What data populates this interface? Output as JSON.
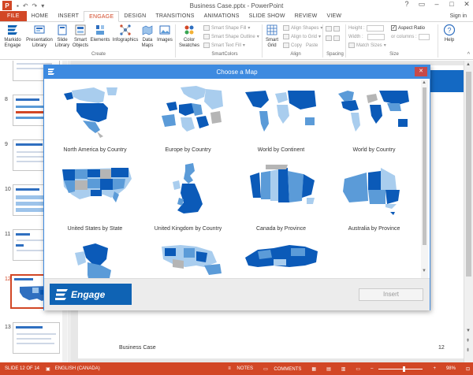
{
  "window": {
    "app_icon": "P",
    "title": "Business Case.pptx - PowerPoint",
    "controls": [
      "?",
      "▭",
      "–",
      "□",
      "✕"
    ]
  },
  "qat": [
    "save-icon",
    "undo-icon",
    "redo-icon",
    "customize-icon"
  ],
  "tabs": [
    "FILE",
    "HOME",
    "INSERT",
    "ENGAGE",
    "DESIGN",
    "TRANSITIONS",
    "ANIMATIONS",
    "SLIDE SHOW",
    "REVIEW",
    "VIEW"
  ],
  "active_tab": "ENGAGE",
  "signin": "Sign in",
  "ribbon": {
    "markido": "Markido\nEngage",
    "presentation_library": "Presentation\nLibrary",
    "slide_library": "Slide\nLibrary",
    "smart_objects": "Smart\nObjects",
    "elements": "Elements",
    "infographics": "Infographics",
    "data_maps": "Data\nMaps",
    "images": "Images",
    "color_swatches": "Color\nSwatches",
    "smart_shape_fill": "Smart Shape Fill",
    "smart_shape_outline": "Smart Shape Outline",
    "smart_text_fill": "Smart Text Fill",
    "smart_grid": "Smart\nGrid",
    "align_shapes": "Align Shapes",
    "align_to_grid": "Align to Grid",
    "copy": "Copy",
    "paste": "Paste",
    "height": "Height :",
    "width": "Width :",
    "aspect_ratio": "Aspect Ratio",
    "or_columns": "or columns :",
    "match_sizes": "Match Sizes",
    "help": "Help",
    "groups": {
      "create": "Create",
      "smartcolors": "SmartColors",
      "align": "Align",
      "spacing": "Spacing",
      "size": "Size"
    }
  },
  "thumbnails": [
    {
      "num": "",
      "selected": false
    },
    {
      "num": "8",
      "selected": false
    },
    {
      "num": "9",
      "selected": false
    },
    {
      "num": "10",
      "selected": false
    },
    {
      "num": "11",
      "selected": false
    },
    {
      "num": "12",
      "selected": true
    },
    {
      "num": "13",
      "selected": false
    }
  ],
  "slide": {
    "footer_left": "Business Case",
    "footer_right": "12"
  },
  "dialog": {
    "title": "Choose a Map",
    "close": "✕",
    "maps": [
      "North America by Country",
      "Europe by Country",
      "World by Continent",
      "World by Country",
      "United States by State",
      "United Kingdom by Country",
      "Canada by Province",
      "Australia by Province",
      "",
      "",
      ""
    ],
    "logo_text": "Engage",
    "insert_label": "Insert"
  },
  "status": {
    "slide_info": "SLIDE 12 OF 14",
    "language": "ENGLISH (CANADA)",
    "notes": "NOTES",
    "comments": "COMMENTS",
    "zoom": "98%",
    "zoom_fraction": 0.55
  },
  "colors": {
    "accent": "#d24726",
    "dialog_blue": "#3d8ae0",
    "engage_blue": "#0f63b4",
    "map_dark": "#0b5ab8",
    "map_mid": "#5b9bd8",
    "map_light": "#a9cdee",
    "map_gray": "#b5b5b5"
  }
}
